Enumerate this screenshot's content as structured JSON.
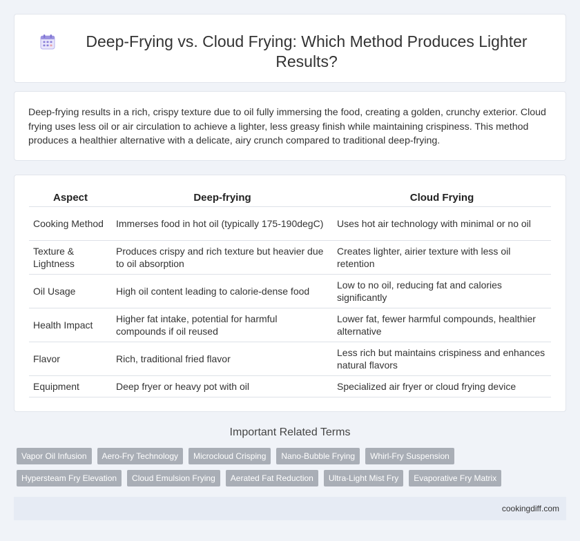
{
  "header": {
    "title": "Deep-Frying vs. Cloud Frying: Which Method Produces Lighter Results?",
    "icon": "calendar-icon"
  },
  "intro": {
    "text": "Deep-frying results in a rich, crispy texture due to oil fully immersing the food, creating a golden, crunchy exterior. Cloud frying uses less oil or air circulation to achieve a lighter, less greasy finish while maintaining crispiness. This method produces a healthier alternative with a delicate, airy crunch compared to traditional deep-frying."
  },
  "table": {
    "headers": [
      "Aspect",
      "Deep-frying",
      "Cloud Frying"
    ],
    "rows": [
      [
        "Cooking Method",
        "Immerses food in hot oil (typically 175-190degC)",
        "Uses hot air technology with minimal or no oil"
      ],
      [
        "Texture & Lightness",
        "Produces crispy and rich texture but heavier due to oil absorption",
        "Creates lighter, airier texture with less oil retention"
      ],
      [
        "Oil Usage",
        "High oil content leading to calorie-dense food",
        "Low to no oil, reducing fat and calories significantly"
      ],
      [
        "Health Impact",
        "Higher fat intake, potential for harmful compounds if oil reused",
        "Lower fat, fewer harmful compounds, healthier alternative"
      ],
      [
        "Flavor",
        "Rich, traditional fried flavor",
        "Less rich but maintains crispiness and enhances natural flavors"
      ],
      [
        "Equipment",
        "Deep fryer or heavy pot with oil",
        "Specialized air fryer or cloud frying device"
      ]
    ]
  },
  "related": {
    "title": "Important Related Terms",
    "tags": [
      "Vapor Oil Infusion",
      "Aero-Fry Technology",
      "Microcloud Crisping",
      "Nano-Bubble Frying",
      "Whirl-Fry Suspension",
      "Hypersteam Fry Elevation",
      "Cloud Emulsion Frying",
      "Aerated Fat Reduction",
      "Ultra-Light Mist Fry",
      "Evaporative Fry Matrix"
    ]
  },
  "footer": {
    "site": "cookingdiff.com"
  },
  "colors": {
    "background": "#f0f3f8",
    "tag": "#a9aeb6",
    "footer": "#e6ebf4",
    "icon_accent": "#8a7fd8"
  }
}
